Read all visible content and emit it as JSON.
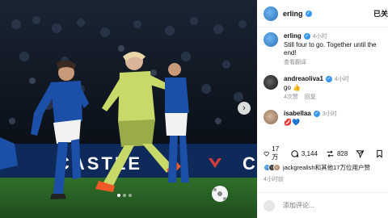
{
  "post": {
    "image_banner_text": "CASTLE",
    "image_banner_text_right": "C",
    "carousel_dots": 3,
    "carousel_active_dot": 0
  },
  "header": {
    "username": "erling",
    "follow_status": "已关"
  },
  "comments": [
    {
      "username": "erling",
      "time": "4小时",
      "text": "Still four to go. Together until the end!",
      "sub": [
        "查看翻译"
      ],
      "avatar": "blue"
    },
    {
      "username": "andreaoliva1",
      "time": "4小时",
      "text": "go 👍",
      "sub": [
        "4次赞",
        "回复"
      ],
      "avatar": "dark"
    },
    {
      "username": "isabellaa",
      "time": "3小时",
      "text": "💋💙",
      "sub": [],
      "avatar": "tan"
    }
  ],
  "actions": {
    "likes": "17 万",
    "comments": "3,144",
    "reposts": "828"
  },
  "liked_by": {
    "text": "jackgrealish和其他17万位用户赞"
  },
  "posted_time": "4小时前",
  "compose": {
    "placeholder": "添加评论..."
  },
  "colors": {
    "verified": "#3897f0",
    "link": "#0095f6"
  }
}
